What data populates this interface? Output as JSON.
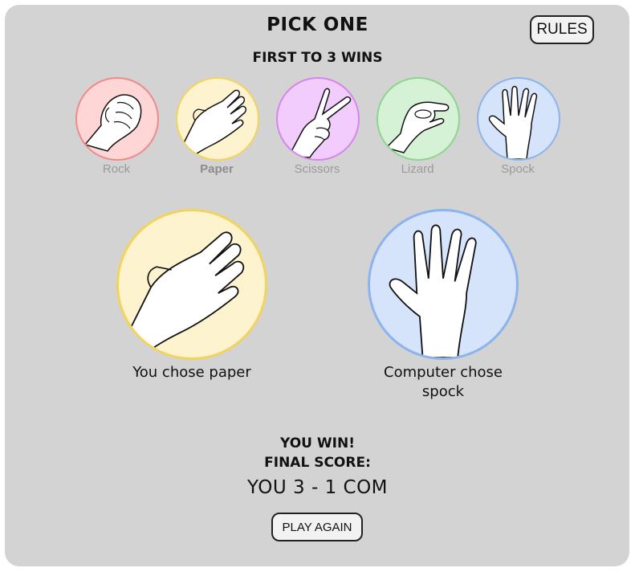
{
  "header": {
    "title": "PICK ONE",
    "subtitle": "FIRST TO 3 WINS",
    "rules_label": "RULES"
  },
  "choices": [
    {
      "label": "Rock",
      "icon": "rock-fist-icon",
      "bg": "#ffd6d6",
      "border": "#f08a8a"
    },
    {
      "label": "Paper",
      "icon": "paper-hand-icon",
      "bg": "#fdf3cf",
      "border": "#f2d45c",
      "selected": true
    },
    {
      "label": "Scissors",
      "icon": "scissors-hand-icon",
      "bg": "#f2ccfc",
      "border": "#d585ec"
    },
    {
      "label": "Lizard",
      "icon": "lizard-hand-icon",
      "bg": "#d6f2d6",
      "border": "#8ed48e"
    },
    {
      "label": "Spock",
      "icon": "spock-hand-icon",
      "bg": "#d6e4fb",
      "border": "#8cb3ee"
    }
  ],
  "player": {
    "caption": "You chose paper",
    "icon": "paper-hand-icon",
    "bg": "#fdf3cf",
    "border": "#f2d45c"
  },
  "computer": {
    "caption_line1": "Computer chose",
    "caption_line2": "spock",
    "icon": "spock-hand-icon",
    "bg": "#d6e4fb",
    "border": "#8cb3ee"
  },
  "result": {
    "outcome": "YOU WIN!",
    "final_label": "FINAL SCORE:",
    "score": "YOU 3 - 1 COM",
    "play_again_label": "PLAY AGAIN"
  },
  "colors": {
    "panel_bg": "#d3d3d3",
    "label_muted": "#9a9a9a"
  }
}
